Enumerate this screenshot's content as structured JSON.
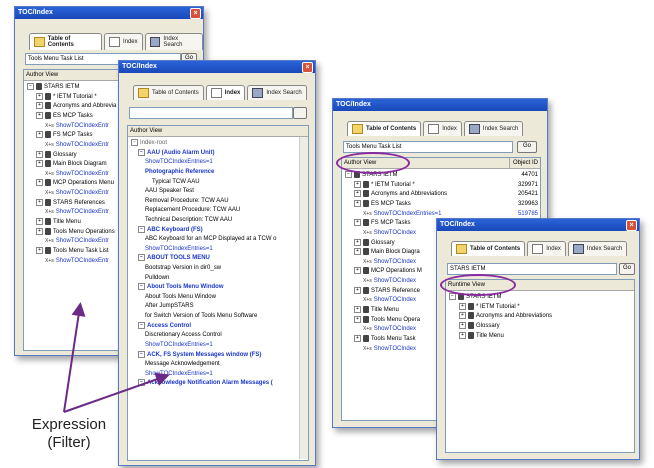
{
  "window1": {
    "title": "TOC/Index",
    "tabs": [
      "Table of Contents",
      "Index",
      "Index Search"
    ],
    "search_value": "Tools Menu Task List",
    "go_label": "Go",
    "header": "Author View",
    "items": [
      {
        "text": "STARS IETM",
        "level": 0,
        "kind": "book",
        "color": "black"
      },
      {
        "text": "* IETM Tutorial *",
        "level": 1,
        "kind": "book",
        "color": "black"
      },
      {
        "text": "Acronyms and Abbrevia",
        "level": 1,
        "kind": "book",
        "color": "black"
      },
      {
        "text": "ES MCP Tasks",
        "level": 1,
        "kind": "book",
        "color": "black"
      },
      {
        "text": "ShowTOCIndexEntr",
        "level": 2,
        "kind": "xr",
        "color": "blue"
      },
      {
        "text": "FS MCP Tasks",
        "level": 1,
        "kind": "book",
        "color": "black"
      },
      {
        "text": "ShowTOCIndexEntr",
        "level": 2,
        "kind": "xr",
        "color": "blue"
      },
      {
        "text": "Glossary",
        "level": 1,
        "kind": "book",
        "color": "black"
      },
      {
        "text": "Main Block Diagram",
        "level": 1,
        "kind": "book",
        "color": "black"
      },
      {
        "text": "ShowTOCIndexEntr",
        "level": 2,
        "kind": "xr",
        "color": "blue"
      },
      {
        "text": "MCP Operations Menu",
        "level": 1,
        "kind": "book",
        "color": "black"
      },
      {
        "text": "ShowTOCIndexEntr",
        "level": 2,
        "kind": "xr",
        "color": "blue"
      },
      {
        "text": "STARS References",
        "level": 1,
        "kind": "book",
        "color": "black"
      },
      {
        "text": "ShowTOCIndexEntr",
        "level": 2,
        "kind": "xr",
        "color": "blue"
      },
      {
        "text": "Title Menu",
        "level": 1,
        "kind": "book",
        "color": "black"
      },
      {
        "text": "Tools Menu Operations",
        "level": 1,
        "kind": "book",
        "color": "black"
      },
      {
        "text": "ShowTOCIndexEntr",
        "level": 2,
        "kind": "xr",
        "color": "blue"
      },
      {
        "text": "Tools Menu Task List",
        "level": 1,
        "kind": "book",
        "color": "black"
      },
      {
        "text": "ShowTOCIndexEntr",
        "level": 2,
        "kind": "xr",
        "color": "blue"
      }
    ]
  },
  "window2": {
    "title": "TOC/Index",
    "tabs": [
      "Table of Contents",
      "Index",
      "Index Search"
    ],
    "header": "Author View",
    "items": [
      {
        "text": "Index-root",
        "level": 0,
        "style": "gray"
      },
      {
        "text": "AAU (Audio Alarm Unit)",
        "level": 1,
        "style": "bold"
      },
      {
        "text": "ShowTOCIndexEntries=1",
        "level": 2,
        "style": "blue"
      },
      {
        "text": "Photographic Reference",
        "level": 2,
        "style": "bold"
      },
      {
        "text": "Typical TCW AAU",
        "level": 3,
        "style": "plain"
      },
      {
        "text": "AAU Speaker Test",
        "level": 2,
        "style": "plain"
      },
      {
        "text": "Removal Procedure:  TCW AAU",
        "level": 2,
        "style": "plain"
      },
      {
        "text": "Replacement Procedure:  TCW AAU",
        "level": 2,
        "style": "plain"
      },
      {
        "text": "Technical Description:  TCW AAU",
        "level": 2,
        "style": "plain"
      },
      {
        "text": "ABC Keyboard (FS)",
        "level": 1,
        "style": "bold"
      },
      {
        "text": "ABC Keyboard for an MCP Displayed at a TCW o",
        "level": 2,
        "style": "plain"
      },
      {
        "text": "ShowTOCIndexEntries=1",
        "level": 2,
        "style": "blue"
      },
      {
        "text": "ABOUT TOOLS MENU",
        "level": 1,
        "style": "bold"
      },
      {
        "text": "Bootstrap Version in dir0_sw",
        "level": 2,
        "style": "plain"
      },
      {
        "text": "Pulldown",
        "level": 2,
        "style": "plain"
      },
      {
        "text": "About Tools Menu Window",
        "level": 1,
        "style": "bold"
      },
      {
        "text": "About Tools Menu Window",
        "level": 2,
        "style": "plain"
      },
      {
        "text": "After JumpSTARS",
        "level": 2,
        "style": "plain"
      },
      {
        "text": "for Switch Version of Tools Menu Software",
        "level": 2,
        "style": "plain"
      },
      {
        "text": "Access Control",
        "level": 1,
        "style": "bold"
      },
      {
        "text": "Discretionary Access Control",
        "level": 2,
        "style": "plain"
      },
      {
        "text": "ShowTOCIndexEntries=1",
        "level": 2,
        "style": "blue"
      },
      {
        "text": "ACK, FS System Messages window (FS)",
        "level": 1,
        "style": "bold"
      },
      {
        "text": "Message Acknowledgement",
        "level": 2,
        "style": "plain"
      },
      {
        "text": "ShowTOCIndexEntries=1",
        "level": 2,
        "style": "blue"
      },
      {
        "text": "Acknowledge Notification Alarm Messages (",
        "level": 1,
        "style": "bold"
      }
    ]
  },
  "window3": {
    "title": "TOC/Index",
    "tabs": [
      "Table of Contents",
      "Index",
      "Index Search"
    ],
    "search_value": "Tools Menu Task List",
    "go_label": "Go",
    "header": "Author View",
    "header2": "Object ID",
    "items": [
      {
        "text": "STARS IETM",
        "level": 0,
        "kind": "book",
        "color": "black",
        "id": "44701"
      },
      {
        "text": "* IETM Tutorial *",
        "level": 1,
        "kind": "book",
        "color": "black",
        "id": "329971"
      },
      {
        "text": "Acronyms and Abbreviations",
        "level": 1,
        "kind": "book",
        "color": "black",
        "id": "205421"
      },
      {
        "text": "ES MCP Tasks",
        "level": 1,
        "kind": "book",
        "color": "black",
        "id": "329963"
      },
      {
        "text": "ShowTOCIndexEntries=1",
        "level": 2,
        "kind": "xr",
        "color": "blue",
        "id": "519785"
      },
      {
        "text": "FS MCP Tasks",
        "level": 1,
        "kind": "book",
        "color": "black",
        "id": ""
      },
      {
        "text": "ShowTOCIndex",
        "level": 2,
        "kind": "xr",
        "color": "blue",
        "id": ""
      },
      {
        "text": "Glossary",
        "level": 1,
        "kind": "book",
        "color": "black",
        "id": ""
      },
      {
        "text": "Main Block Diagra",
        "level": 1,
        "kind": "book",
        "color": "black",
        "id": ""
      },
      {
        "text": "ShowTOCIndex",
        "level": 2,
        "kind": "xr",
        "color": "blue",
        "id": ""
      },
      {
        "text": "MCP Operations M",
        "level": 1,
        "kind": "book",
        "color": "black",
        "id": ""
      },
      {
        "text": "ShowTOCIndex",
        "level": 2,
        "kind": "xr",
        "color": "blue",
        "id": ""
      },
      {
        "text": "STARS Reference",
        "level": 1,
        "kind": "book",
        "color": "black",
        "id": ""
      },
      {
        "text": "ShowTOCIndex",
        "level": 2,
        "kind": "xr",
        "color": "blue",
        "id": ""
      },
      {
        "text": "Title Menu",
        "level": 1,
        "kind": "book",
        "color": "black",
        "id": ""
      },
      {
        "text": "Tools Menu Opera",
        "level": 1,
        "kind": "book",
        "color": "black",
        "id": ""
      },
      {
        "text": "ShowTOCIndex",
        "level": 2,
        "kind": "xr",
        "color": "blue",
        "id": ""
      },
      {
        "text": "Tools Menu Task",
        "level": 1,
        "kind": "book",
        "color": "black",
        "id": ""
      },
      {
        "text": "ShowTOCIndex",
        "level": 2,
        "kind": "xr",
        "color": "blue",
        "id": ""
      }
    ]
  },
  "window4": {
    "title": "TOC/Index",
    "tabs": [
      "Table of Contents",
      "Index",
      "Index Search"
    ],
    "search_value": "STARS IETM",
    "go_label": "Go",
    "header": "Runtime View",
    "items": [
      {
        "text": "STARS IETM",
        "level": 0,
        "kind": "book",
        "color": "black"
      },
      {
        "text": "* IETM Tutorial *",
        "level": 1,
        "kind": "book",
        "color": "black"
      },
      {
        "text": "Acronyms and Abbreviations",
        "level": 1,
        "kind": "book",
        "color": "black"
      },
      {
        "text": "Glossary",
        "level": 1,
        "kind": "book",
        "color": "black"
      },
      {
        "text": "Title Menu",
        "level": 1,
        "kind": "book",
        "color": "black"
      }
    ]
  },
  "annotation": {
    "line1": "Expression",
    "line2": "(Filter)"
  },
  "colors": {
    "titlebar": "#1a48b8",
    "link": "#1a36c8",
    "highlight_oval": "#8b2aa0",
    "arrow": "#6a2a86"
  }
}
